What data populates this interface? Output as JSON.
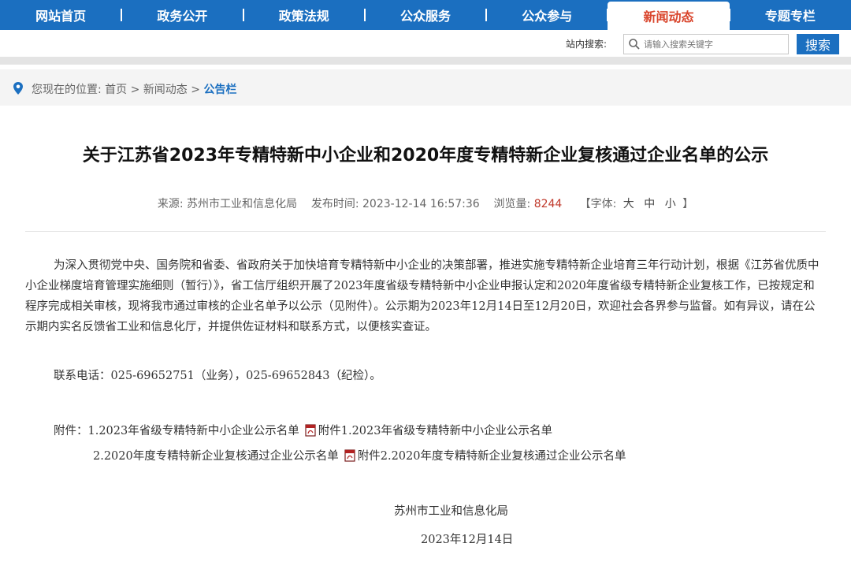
{
  "nav": {
    "items": [
      {
        "label": "网站首页"
      },
      {
        "label": "政务公开"
      },
      {
        "label": "政策法规"
      },
      {
        "label": "公众服务"
      },
      {
        "label": "公众参与"
      },
      {
        "label": "新闻动态",
        "active": true
      },
      {
        "label": "专题专栏"
      }
    ],
    "active_color": "#d9452c",
    "bg_color": "#1b6fc0"
  },
  "search": {
    "label": "站内搜索:",
    "placeholder": "请输入搜索关键字",
    "button": "搜索"
  },
  "breadcrumb": {
    "prefix": "您现在的位置:",
    "home": "首页",
    "sep": ">",
    "section": "新闻动态",
    "current": "公告栏"
  },
  "article": {
    "title": "关于江苏省2023年专精特新中小企业和2020年度专精特新企业复核通过企业名单的公示",
    "meta": {
      "source_label": "来源:",
      "source": "苏州市工业和信息化局",
      "time_label": "发布时间:",
      "time": "2023-12-14 16:57:36",
      "views_label": "浏览量:",
      "views": "8244",
      "font_label_open": "【字体:",
      "font_large": "大",
      "font_medium": "中",
      "font_small": "小",
      "font_label_close": "】"
    },
    "paragraph": "为深入贯彻党中央、国务院和省委、省政府关于加快培育专精特新中小企业的决策部署，推进实施专精特新企业培育三年行动计划，根据《江苏省优质中小企业梯度培育管理实施细则（暂行）》，省工信厅组织开展了2023年度省级专精特新中小企业申报认定和2020年度省级专精特新企业复核工作，已按规定和程序完成相关审核，现将我市通过审核的企业名单予以公示（见附件）。公示期为2023年12月14日至12月20日，欢迎社会各界参与监督。如有异议，请在公示期内实名反馈省工业和信息化厅，并提供佐证材料和联系方式，以便核实查证。",
    "phone": "联系电话：025-69652751（业务），025-69652843（纪检）。",
    "attachments_label": "附件：",
    "attachments": [
      {
        "text": "1.2023年省级专精特新中小企业公示名单",
        "link": "附件1.2023年省级专精特新中小企业公示名单"
      },
      {
        "text": "2.2020年度专精特新企业复核通过企业公示名单",
        "link": "附件2.2020年度专精特新企业复核通过企业公示名单"
      }
    ],
    "sign_org": "苏州市工业和信息化局",
    "sign_date": "2023年12月14日"
  }
}
